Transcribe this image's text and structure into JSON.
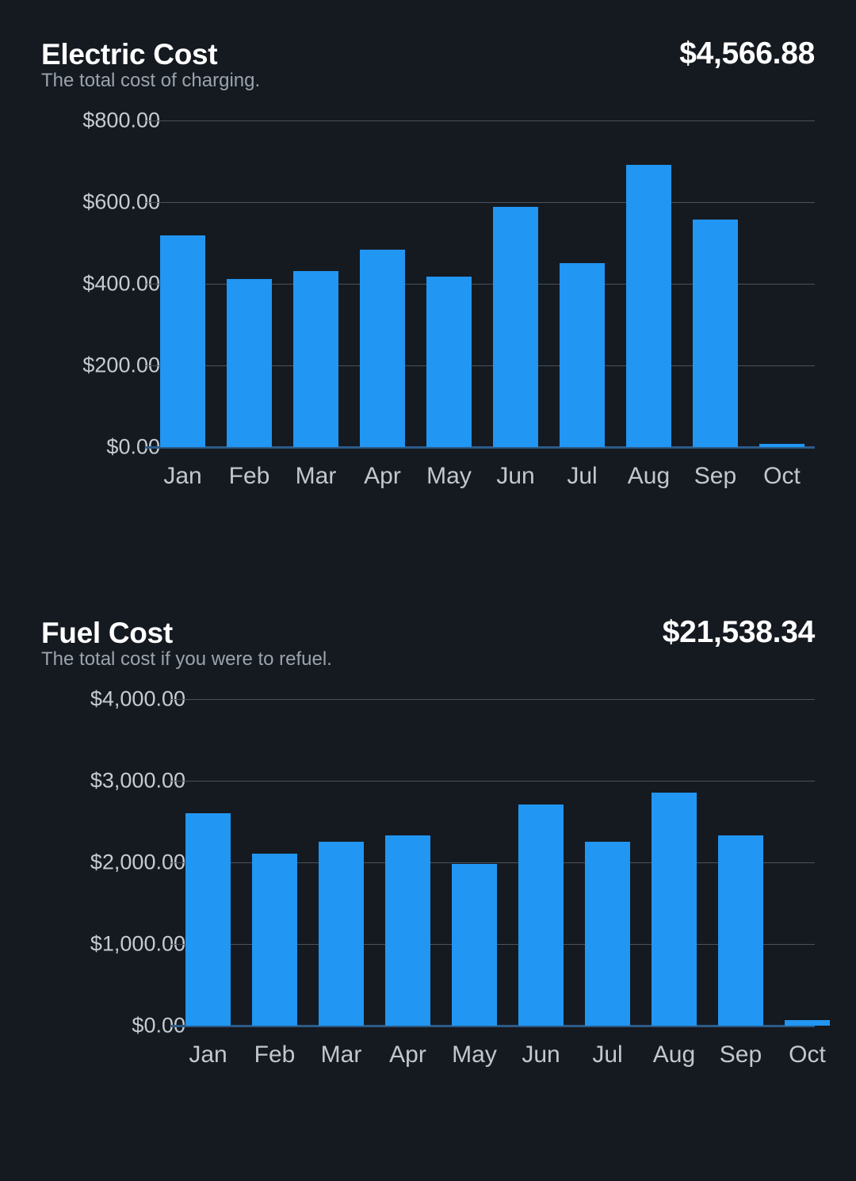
{
  "theme": {
    "background": "#151a21",
    "bar_color": "#2196f3",
    "grid_color": "#4b525c",
    "baseline_color": "#2b5a88",
    "title_color": "#ffffff",
    "subtitle_color": "#9ba3ad",
    "tick_color": "#c6cbd2"
  },
  "cards": [
    {
      "title": "Electric Cost",
      "total": "$4,566.88",
      "subtitle": "The total cost of charging."
    },
    {
      "title": "Fuel Cost",
      "total": "$21,538.34",
      "subtitle": "The total cost if you were to refuel."
    }
  ],
  "chart_data": [
    {
      "type": "bar",
      "title": "Electric Cost",
      "subtitle": "The total cost of charging.",
      "total": "$4,566.88",
      "xlabel": "",
      "ylabel": "",
      "categories": [
        "Jan",
        "Feb",
        "Mar",
        "Apr",
        "May",
        "Jun",
        "Jul",
        "Aug",
        "Sep",
        "Oct"
      ],
      "values": [
        518,
        412,
        431,
        483,
        418,
        588,
        450,
        691,
        557,
        8
      ],
      "ylim": [
        0,
        800
      ],
      "yticks": [
        0,
        200,
        400,
        600,
        800
      ],
      "ytick_labels": [
        "$0.00",
        "$200.00",
        "$400.00",
        "$600.00",
        "$800.00"
      ],
      "grid": true,
      "legend": "none",
      "bar_color": "#2196f3"
    },
    {
      "type": "bar",
      "title": "Fuel Cost",
      "subtitle": "The total cost if you were to refuel.",
      "total": "$21,538.34",
      "xlabel": "",
      "ylabel": "",
      "categories": [
        "Jan",
        "Feb",
        "Mar",
        "Apr",
        "May",
        "Jun",
        "Jul",
        "Aug",
        "Sep",
        "Oct"
      ],
      "values": [
        2600,
        2110,
        2250,
        2335,
        1980,
        2710,
        2250,
        2855,
        2335,
        68
      ],
      "ylim": [
        0,
        4000
      ],
      "yticks": [
        0,
        1000,
        2000,
        3000,
        4000
      ],
      "ytick_labels": [
        "$0.00",
        "$1,000.00",
        "$2,000.00",
        "$3,000.00",
        "$4,000.00"
      ],
      "grid": true,
      "legend": "none",
      "bar_color": "#2196f3"
    }
  ]
}
